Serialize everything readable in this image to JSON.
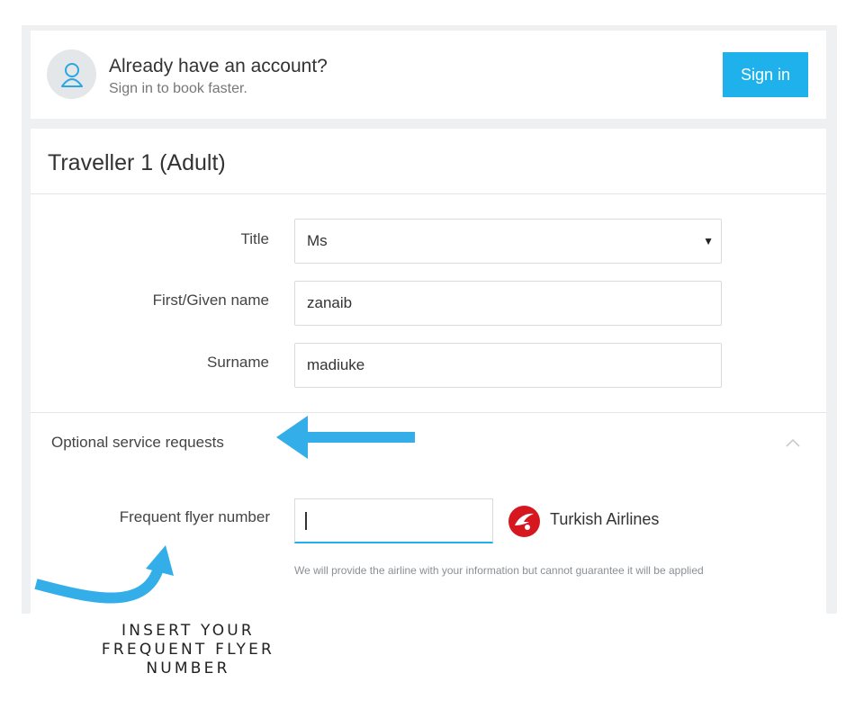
{
  "account": {
    "title": "Already have an account?",
    "subtitle": "Sign in to book faster.",
    "signin_label": "Sign in"
  },
  "traveller": {
    "heading": "Traveller 1 (Adult)",
    "fields": {
      "title": {
        "label": "Title",
        "value": "Ms"
      },
      "first_name": {
        "label": "First/Given name",
        "value": "zanaib"
      },
      "surname": {
        "label": "Surname",
        "value": "madiuke"
      }
    },
    "optional": {
      "label": "Optional service requests",
      "frequent_flyer_label": "Frequent flyer number",
      "frequent_flyer_value": "",
      "airline": "Turkish Airlines",
      "disclaimer": "We will provide the airline with your information but cannot guarantee it will be applied"
    }
  },
  "annotation": {
    "callout_line1": "INSERT YOUR",
    "callout_line2": "FREQUENT FLYER",
    "callout_line3": "NUMBER",
    "arrow_color": "#33aee8"
  },
  "colors": {
    "accent": "#1eb1ec",
    "airline_red": "#d7171f"
  },
  "icons": {
    "avatar": "user-icon",
    "select_caret": "caret-down-icon",
    "collapse": "chevron-up-icon",
    "airline": "turkish-airlines-logo"
  }
}
